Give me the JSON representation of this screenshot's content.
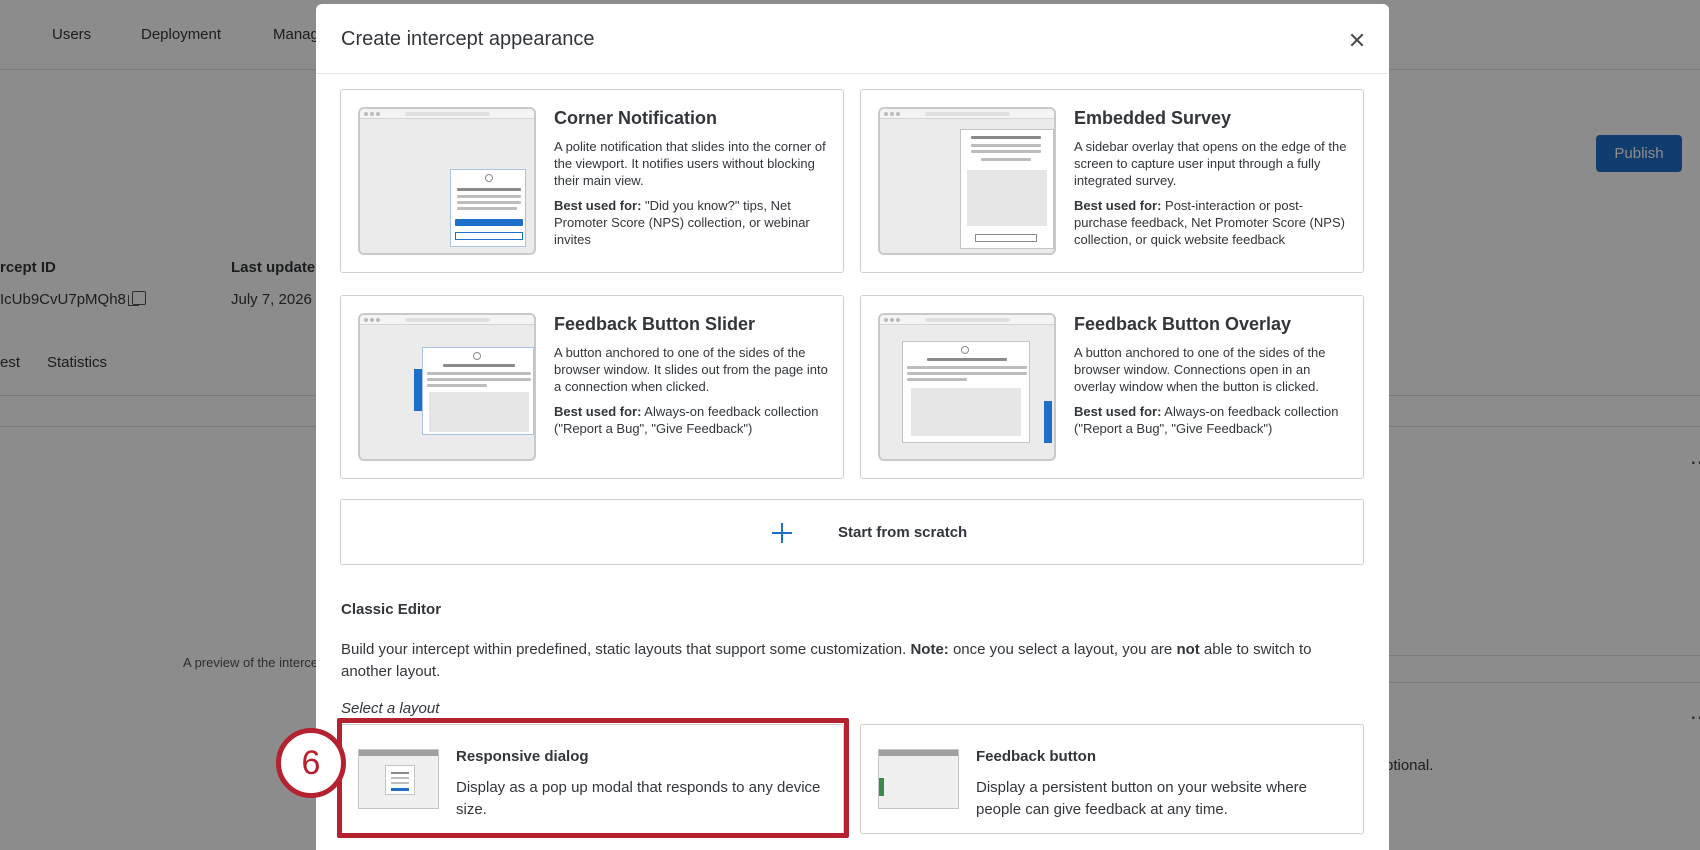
{
  "background": {
    "nav": [
      "Users",
      "Deployment",
      "Manag"
    ],
    "publish_label": "Publish",
    "intercept_id_label": "rcept ID",
    "intercept_id_value": "IcUb9CvU7pMQh8",
    "last_updated_label": "Last update",
    "last_updated_value": "July 7, 2026",
    "tabs": [
      "est",
      "Statistics"
    ],
    "preview_text": "A preview of the interce",
    "optional_text": "ptional."
  },
  "modal": {
    "title": "Create intercept appearance",
    "cards": [
      {
        "title": "Corner Notification",
        "desc": "A polite notification that slides into the corner of the viewport. It notifies users without blocking their main view.",
        "best_label": "Best used for:",
        "best_text": " \"Did you know?\" tips, Net Promoter Score (NPS) collection, or webinar invites"
      },
      {
        "title": "Embedded Survey",
        "desc": "A sidebar overlay that opens on the edge of the screen to capture user input through a fully integrated survey.",
        "best_label": "Best used for:",
        "best_text": " Post-interaction or post-purchase feedback, Net Promoter Score (NPS) collection, or quick website feedback"
      },
      {
        "title": "Feedback Button Slider",
        "desc": "A button anchored to one of the sides of the browser window. It slides out from the page into a connection when clicked.",
        "best_label": "Best used for:",
        "best_text": " Always-on feedback collection (\"Report a Bug\", \"Give Feedback\")"
      },
      {
        "title": "Feedback Button Overlay",
        "desc": "A button anchored to one of the sides of the browser window. Connections open in an overlay window when the button is clicked.",
        "best_label": "Best used for:",
        "best_text": " Always-on feedback collection (\"Report a Bug\", \"Give Feedback\")"
      }
    ],
    "scratch_label": "Start from scratch",
    "classic_heading": "Classic Editor",
    "classic_text_1": "Build your intercept within predefined, static layouts that support some customization. ",
    "classic_note": "Note:",
    "classic_text_2": " once you select a layout, you are ",
    "classic_not": "not",
    "classic_text_3": " able to switch to another layout.",
    "select_layout": "Select a layout",
    "layouts": [
      {
        "title": "Responsive dialog",
        "desc": "Display as a pop up modal that responds to any device size."
      },
      {
        "title": "Feedback button",
        "desc": "Display a persistent button on your website where people can give feedback at any time."
      }
    ]
  },
  "step_number": "6",
  "colors": {
    "accent": "#1e6fc9",
    "highlight": "#b5212e"
  }
}
